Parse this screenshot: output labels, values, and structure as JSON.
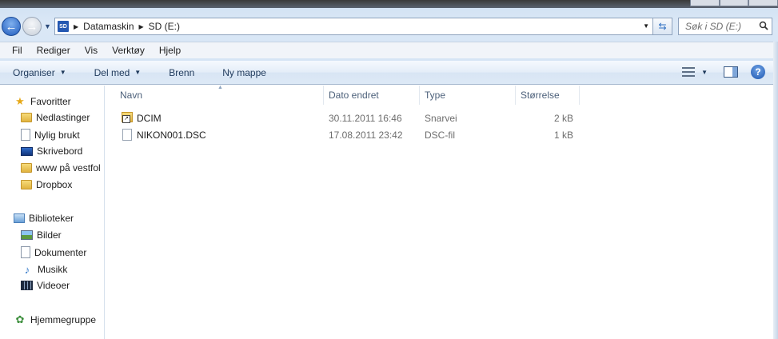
{
  "address_bar": {
    "crumbs": [
      "Datamaskin",
      "SD (E:)"
    ],
    "drive_badge": "SD"
  },
  "search": {
    "placeholder": "Søk i SD (E:)"
  },
  "menu": [
    "Fil",
    "Rediger",
    "Vis",
    "Verktøy",
    "Hjelp"
  ],
  "toolbar": {
    "organize": "Organiser",
    "share": "Del med",
    "burn": "Brenn",
    "new_folder": "Ny mappe"
  },
  "nav": {
    "favorites_header": "Favoritter",
    "favorites": [
      "Nedlastinger",
      "Nylig brukt",
      "Skrivebord",
      "www på vestfol",
      "Dropbox"
    ],
    "libraries_header": "Biblioteker",
    "libraries": [
      "Bilder",
      "Dokumenter",
      "Musikk",
      "Videoer"
    ],
    "homegroup": "Hjemmegruppe"
  },
  "columns": [
    "Navn",
    "Dato endret",
    "Type",
    "Størrelse"
  ],
  "files": [
    {
      "name": "DCIM",
      "date": "30.11.2011 16:46",
      "type": "Snarvei",
      "size": "2 kB",
      "icon": "shortcut-icon"
    },
    {
      "name": "NIKON001.DSC",
      "date": "17.08.2011 23:42",
      "type": "DSC-fil",
      "size": "1 kB",
      "icon": "file-icon"
    }
  ],
  "colors": {
    "toolbar_text": "#1e395b",
    "column_header_text": "#4c607a",
    "accent": "#1f5bbd"
  }
}
